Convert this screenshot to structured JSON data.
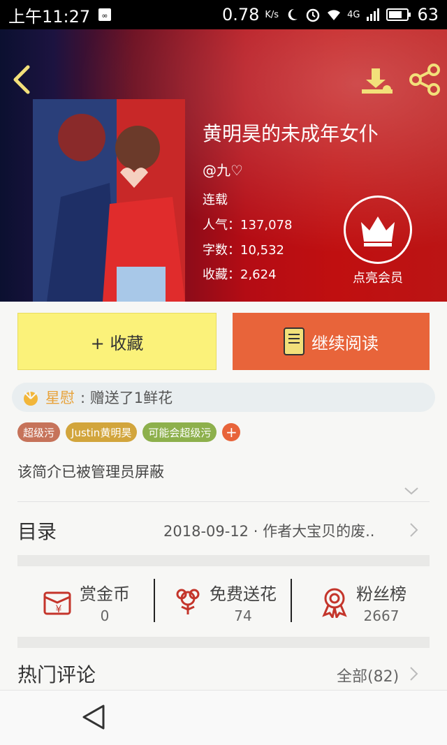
{
  "status_bar": {
    "time": "上午11:27",
    "net_speed": "0.78",
    "net_unit": "K/s",
    "network": "4G",
    "battery": "63"
  },
  "book": {
    "title": "黄明昊的未成年女仆",
    "author": "@九♡",
    "status": "连载",
    "stats": [
      {
        "label": "人气：",
        "value": "137,078"
      },
      {
        "label": "字数：",
        "value": "10,532"
      },
      {
        "label": "收藏：",
        "value": "2,624"
      }
    ]
  },
  "vip": {
    "label": "点亮会员"
  },
  "actions": {
    "favorite": "+ 收藏",
    "read": "继续阅读"
  },
  "gift": {
    "user": "星慰",
    "message": ": 赠送了1鲜花"
  },
  "tags": [
    {
      "label": "超级污",
      "color": "#c6735a"
    },
    {
      "label": "Justin黄明昊",
      "color": "#d2a53c"
    },
    {
      "label": "可能会超级污",
      "color": "#8db04c"
    }
  ],
  "intro": "该简介已被管理员屏蔽",
  "toc": {
    "label": "目录",
    "latest": "2018-09-12 · 作者大宝贝的废.."
  },
  "rewards": [
    {
      "label": "赏金币",
      "count": "0",
      "icon": "coin-envelope-icon"
    },
    {
      "label": "免费送花",
      "count": "74",
      "icon": "flower-icon"
    },
    {
      "label": "粉丝榜",
      "count": "2667",
      "icon": "medal-icon"
    }
  ],
  "comments": {
    "label": "热门评论",
    "all": "全部(82)"
  },
  "colors": {
    "accent": "#e8643a",
    "favorite_bg": "#fbf27a",
    "icon_yellow": "#f2e07a",
    "reward_red": "#c4352b"
  }
}
